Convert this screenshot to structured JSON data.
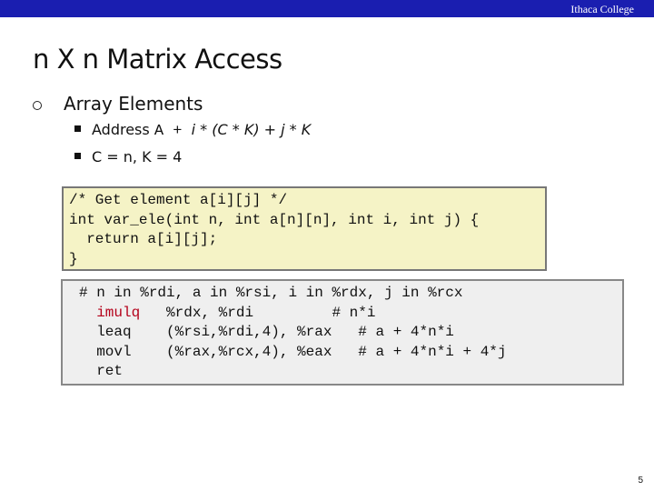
{
  "header": {
    "brand": "Ithaca College"
  },
  "slide": {
    "title": "n X n Matrix Access",
    "bullet": "Array Elements",
    "sub1": {
      "prefix": "Address ",
      "code": "A + ",
      "formula": "i * (C * K) + j * K"
    },
    "sub2": "C = n, K = 4"
  },
  "c_code": [
    "/* Get element a[i][j] */",
    "int var_ele(int n, int a[n][n], int i, int j) {",
    "  return a[i][j];",
    "}"
  ],
  "asm": {
    "comment": "# n in %rdi, a in %rsi, i in %rdx, j in %rcx",
    "lines": [
      {
        "op": "imulq",
        "args": "%rdx, %rdi      ",
        "cmt": "# n*i"
      },
      {
        "op": "leaq ",
        "args": "(%rsi,%rdi,4), %rax",
        "cmt": "# a + 4*n*i"
      },
      {
        "op": "movl ",
        "args": "(%rax,%rcx,4), %eax",
        "cmt": "# a + 4*n*i + 4*j"
      },
      {
        "op": "ret",
        "args": "",
        "cmt": ""
      }
    ]
  },
  "colors": {
    "header_bar": "#1a1eb0",
    "c_box": "#f5f3c6",
    "asm_box": "#efefef",
    "highlight": "#b4001a"
  },
  "page_number": "5"
}
